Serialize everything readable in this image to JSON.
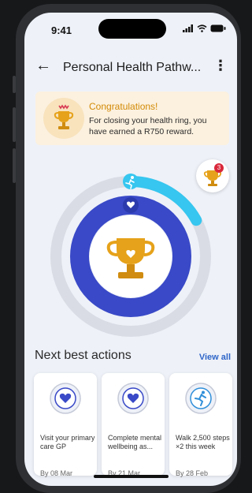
{
  "status": {
    "time": "9:41"
  },
  "header": {
    "title": "Personal Health Pathw...",
    "back_icon": "arrow-left-icon",
    "menu_icon": "kebab-icon"
  },
  "banner": {
    "title": "Congratulations!",
    "text": "For closing your health ring, you have earned a R750 reward.",
    "icon": "trophy-icon"
  },
  "ring": {
    "outer_progress": 0.17,
    "outer_icon": "runner-icon",
    "inner_icon": "heart-icon",
    "center_icon": "trophy-icon",
    "colors": {
      "track": "#d9dce4",
      "inner": "#3949c7",
      "outer": "#36c6ef",
      "trophy": "#e6a21a"
    }
  },
  "badge": {
    "count": "3",
    "icon": "trophy-icon"
  },
  "next_actions": {
    "title": "Next best actions",
    "view_all": "View all",
    "cards": [
      {
        "text": "Visit your primary care GP",
        "date": "By 08 Mar",
        "icon": "heart-icon"
      },
      {
        "text": "Complete mental wellbeing as...",
        "date": "By 21 Mar",
        "icon": "heart-icon"
      },
      {
        "text": "Walk 2,500 steps ×2 this week",
        "date": "By 28 Feb",
        "icon": "runner-icon"
      }
    ]
  }
}
